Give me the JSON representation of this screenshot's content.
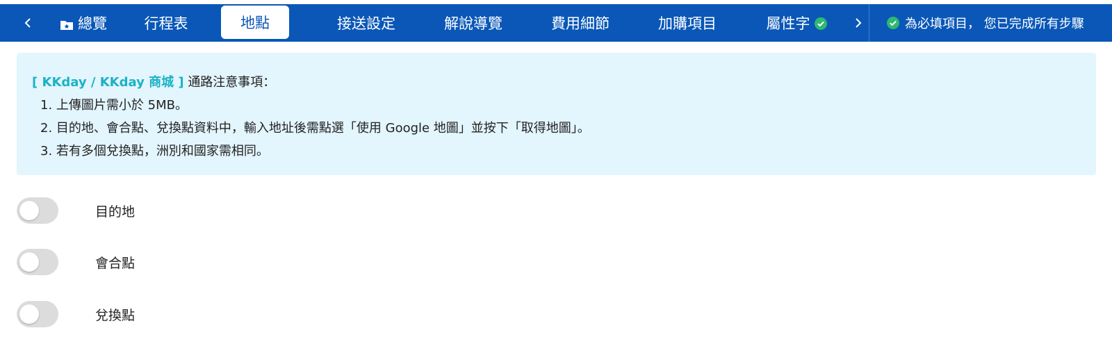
{
  "nav": {
    "prev_icon": "chevron-left-icon",
    "next_icon": "chevron-right-icon",
    "tabs": [
      {
        "label": "總覽",
        "icon": "folder-star-icon"
      },
      {
        "label": "行程表"
      },
      {
        "label": "地點",
        "active": true
      },
      {
        "label": "接送設定"
      },
      {
        "label": "解說導覽"
      },
      {
        "label": "費用細節"
      },
      {
        "label": "加購項目"
      },
      {
        "label": "屬性字",
        "icon": "check-circle-icon"
      }
    ],
    "status_text": "為必填項目， 您已完成所有步驟"
  },
  "notice": {
    "brand": "[ KKday / KKday 商城 ]",
    "heading": "通路注意事項：",
    "items": [
      "1. 上傳圖片需小於 5MB。",
      "2. 目的地、會合點、兌換點資料中，輸入地址後需點選「使用 Google 地圖」並按下「取得地圖」。",
      "3. 若有多個兌換點，洲別和國家需相同。"
    ]
  },
  "toggles": [
    {
      "label": "目的地",
      "checked": false
    },
    {
      "label": "會合點",
      "checked": false
    },
    {
      "label": "兌換點",
      "checked": false
    }
  ],
  "colors": {
    "nav_bg": "#0a57b8",
    "check_green": "#2eb872",
    "brand_teal": "#19b2c5",
    "notice_bg": "#e3f5fd",
    "toggle_off": "#dcdcdc"
  }
}
